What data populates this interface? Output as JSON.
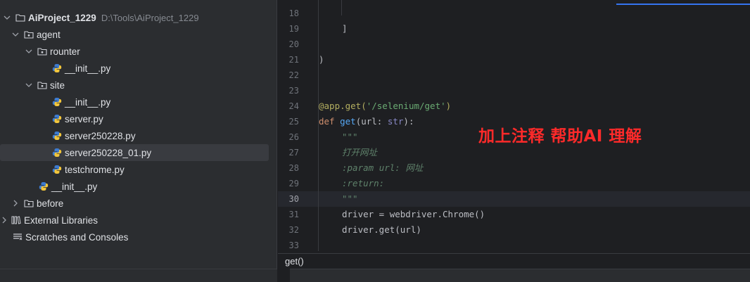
{
  "project_tree": {
    "root": {
      "name": "AiProject_1229",
      "path": "D:\\Tools\\AiProject_1229"
    },
    "items": [
      {
        "label": "agent"
      },
      {
        "label": "rounter"
      },
      {
        "label": "__init__.py"
      },
      {
        "label": "site"
      },
      {
        "label": "__init__.py"
      },
      {
        "label": "server.py"
      },
      {
        "label": "server250228.py"
      },
      {
        "label": "server250228_01.py"
      },
      {
        "label": "testchrome.py"
      },
      {
        "label": "__init__.py"
      },
      {
        "label": "before"
      },
      {
        "label": "External Libraries"
      },
      {
        "label": "Scratches and Consoles"
      }
    ]
  },
  "editor": {
    "line_numbers": [
      "18",
      "19",
      "20",
      "21",
      "22",
      "23",
      "24",
      "25",
      "26",
      "27",
      "28",
      "29",
      "30",
      "31",
      "32",
      "33"
    ],
    "current_line": "30",
    "code": {
      "l19": "]",
      "l21": ")",
      "l24_deco": "@app.get(",
      "l24_str": "'/selenium/get'",
      "l24_end": ")",
      "l25_kw": "def ",
      "l25_fn": "get",
      "l25_rest1": "(url: ",
      "l25_builtin": "str",
      "l25_rest2": "):",
      "l26": "\"\"\"",
      "l27": "打开网址",
      "l28_tag": ":param ",
      "l28_name": "url",
      "l28_rest": ": 网址",
      "l29": ":return:",
      "l30": "\"\"\"",
      "l31": "driver = webdriver.Chrome()",
      "l32": "driver.get(url)"
    },
    "annotation": "加上注释 帮助AI 理解",
    "accent_color": "#3574f0"
  },
  "breadcrumb": {
    "text": "get()"
  }
}
